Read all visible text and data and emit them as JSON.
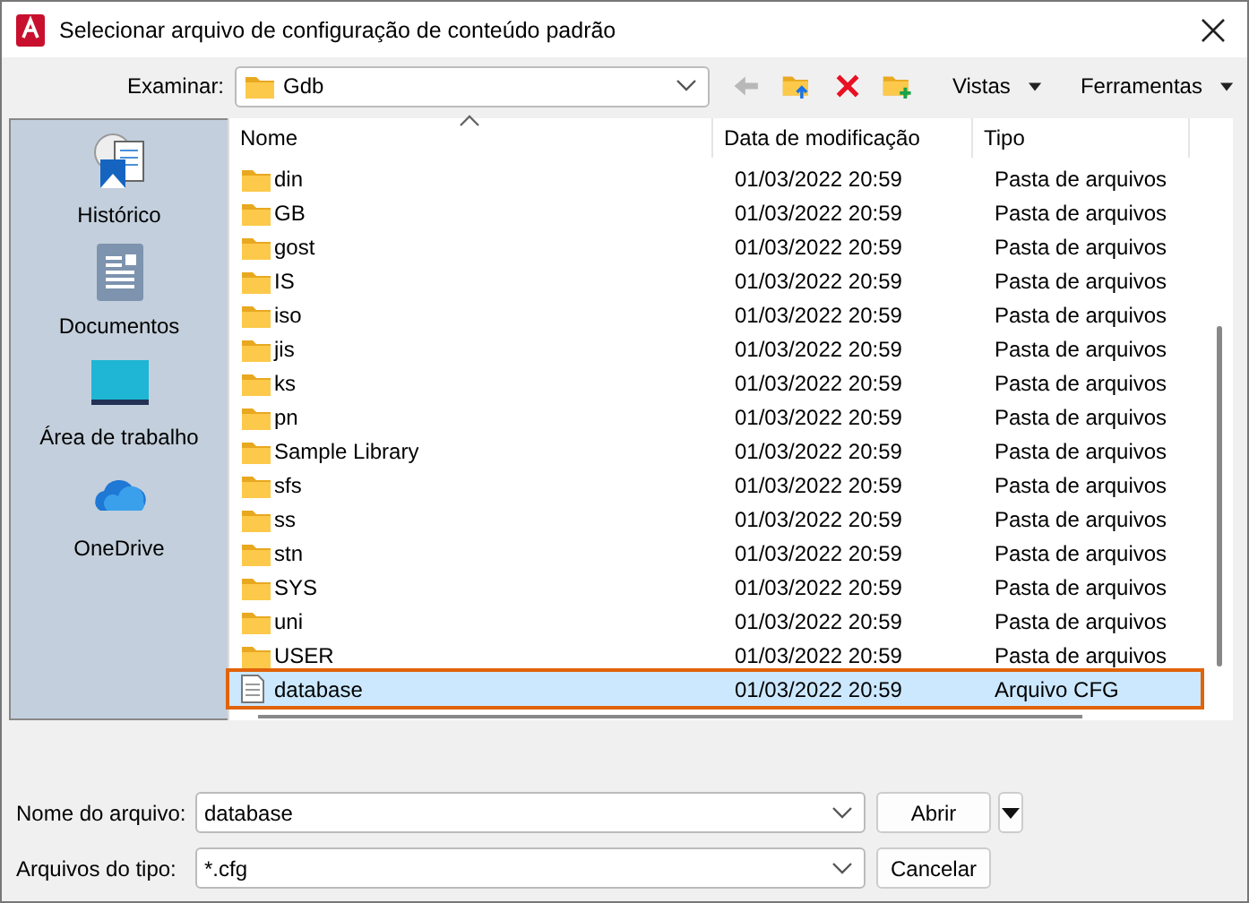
{
  "window": {
    "title": "Selecionar arquivo de configuração de conteúdo padrão"
  },
  "toolbar": {
    "label": "Examinar:",
    "location": "Gdb",
    "views": "Vistas",
    "tools": "Ferramentas"
  },
  "places": [
    {
      "label": "Histórico",
      "kind": "history"
    },
    {
      "label": "Documentos",
      "kind": "documents"
    },
    {
      "label": "Área de trabalho",
      "kind": "desktop"
    },
    {
      "label": "OneDrive",
      "kind": "cloud"
    }
  ],
  "table": {
    "columns": [
      "Nome",
      "Data de modificação",
      "Tipo"
    ],
    "rows": [
      {
        "kind": "folder",
        "name": "din",
        "date": "01/03/2022 20:59",
        "type": "Pasta de arquivos",
        "selected": false,
        "highlighted": false
      },
      {
        "kind": "folder",
        "name": "GB",
        "date": "01/03/2022 20:59",
        "type": "Pasta de arquivos",
        "selected": false,
        "highlighted": false
      },
      {
        "kind": "folder",
        "name": "gost",
        "date": "01/03/2022 20:59",
        "type": "Pasta de arquivos",
        "selected": false,
        "highlighted": false
      },
      {
        "kind": "folder",
        "name": "IS",
        "date": "01/03/2022 20:59",
        "type": "Pasta de arquivos",
        "selected": false,
        "highlighted": false
      },
      {
        "kind": "folder",
        "name": "iso",
        "date": "01/03/2022 20:59",
        "type": "Pasta de arquivos",
        "selected": false,
        "highlighted": false
      },
      {
        "kind": "folder",
        "name": "jis",
        "date": "01/03/2022 20:59",
        "type": "Pasta de arquivos",
        "selected": false,
        "highlighted": false
      },
      {
        "kind": "folder",
        "name": "ks",
        "date": "01/03/2022 20:59",
        "type": "Pasta de arquivos",
        "selected": false,
        "highlighted": false
      },
      {
        "kind": "folder",
        "name": "pn",
        "date": "01/03/2022 20:59",
        "type": "Pasta de arquivos",
        "selected": false,
        "highlighted": false
      },
      {
        "kind": "folder",
        "name": "Sample Library",
        "date": "01/03/2022 20:59",
        "type": "Pasta de arquivos",
        "selected": false,
        "highlighted": false
      },
      {
        "kind": "folder",
        "name": "sfs",
        "date": "01/03/2022 20:59",
        "type": "Pasta de arquivos",
        "selected": false,
        "highlighted": false
      },
      {
        "kind": "folder",
        "name": "ss",
        "date": "01/03/2022 20:59",
        "type": "Pasta de arquivos",
        "selected": false,
        "highlighted": false
      },
      {
        "kind": "folder",
        "name": "stn",
        "date": "01/03/2022 20:59",
        "type": "Pasta de arquivos",
        "selected": false,
        "highlighted": false
      },
      {
        "kind": "folder",
        "name": "SYS",
        "date": "01/03/2022 20:59",
        "type": "Pasta de arquivos",
        "selected": false,
        "highlighted": false
      },
      {
        "kind": "folder",
        "name": "uni",
        "date": "01/03/2022 20:59",
        "type": "Pasta de arquivos",
        "selected": false,
        "highlighted": false
      },
      {
        "kind": "folder",
        "name": "USER",
        "date": "01/03/2022 20:59",
        "type": "Pasta de arquivos",
        "selected": false,
        "highlighted": false
      },
      {
        "kind": "file",
        "name": "database",
        "date": "01/03/2022 20:59",
        "type": "Arquivo CFG",
        "selected": true,
        "highlighted": true
      }
    ]
  },
  "filename": {
    "label": "Nome do arquivo:",
    "value": "database"
  },
  "filetype": {
    "label": "Arquivos do tipo:",
    "value": "*.cfg"
  },
  "buttons": [
    "Abrir",
    "Cancelar"
  ]
}
